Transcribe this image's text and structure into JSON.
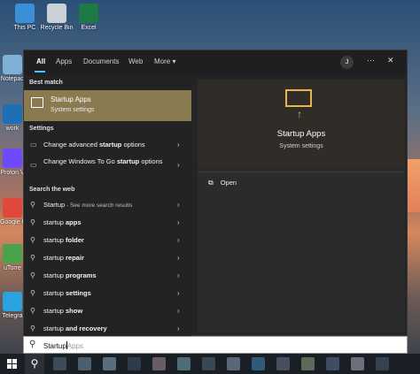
{
  "desktop": {
    "icons": [
      {
        "label": "This PC",
        "color": "#3b8fd8"
      },
      {
        "label": "Recycle Bin",
        "color": "#c8d0d8"
      },
      {
        "label": "Excel",
        "color": "#1e7a45"
      },
      {
        "label": "Notepad",
        "color": "#7fb0d6"
      },
      {
        "label": "work",
        "color": "#1f6fb7"
      },
      {
        "label": "Proton V",
        "color": "#6d4aff"
      },
      {
        "label": "Google Chrom",
        "color": "#e0483b"
      },
      {
        "label": "uTorre",
        "color": "#4aa24a"
      },
      {
        "label": "Telegra",
        "color": "#2aa3df"
      }
    ]
  },
  "tabs": [
    "All",
    "Apps",
    "Documents",
    "Web",
    "More ▾"
  ],
  "avatar_letter": "J",
  "top_icons": {
    "more": "···",
    "close": "✕"
  },
  "left": {
    "best_match_heading": "Best match",
    "best_match": {
      "title": "Startup Apps",
      "subtitle": "System settings"
    },
    "settings_heading": "Settings",
    "settings": [
      {
        "pre": "Change advanced ",
        "bold": "startup",
        "post": " options"
      },
      {
        "pre": "Change Windows To Go ",
        "bold": "startup",
        "post": " options"
      }
    ],
    "web_heading": "Search the web",
    "web_top": {
      "text": "Startup",
      "dim": " - See more search results"
    },
    "web": [
      {
        "pre": "startup ",
        "bold": "apps"
      },
      {
        "pre": "startup ",
        "bold": "folder"
      },
      {
        "pre": "startup ",
        "bold": "repair"
      },
      {
        "pre": "startup ",
        "bold": "programs"
      },
      {
        "pre": "startup ",
        "bold": "settings"
      },
      {
        "pre": "startup ",
        "bold": "show"
      },
      {
        "pre": "startup ",
        "bold": "and recovery"
      }
    ],
    "chevron": "›"
  },
  "right": {
    "title": "Startup Apps",
    "subtitle": "System settings",
    "open_label": "Open",
    "accent": "#e8b34a"
  },
  "search": {
    "typed": "Startup",
    "ghost": "Apps"
  },
  "taskbar": {
    "apps": [
      "#3d4a5a",
      "#4b5f72",
      "#5a6d7e",
      "#2e3b4a",
      "#6a5c63",
      "#4e6b7a",
      "#3a4756",
      "#596779",
      "#2f5a7a",
      "#474f5e",
      "#5c6a5a",
      "#3e4d63",
      "#6b6f7e",
      "#354252"
    ]
  }
}
